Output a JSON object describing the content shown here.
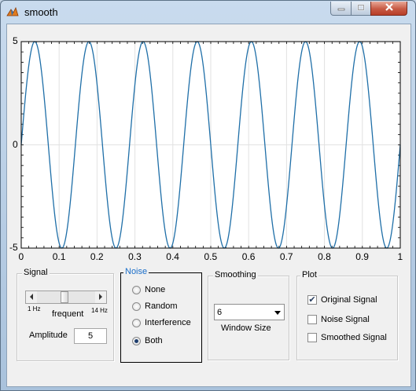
{
  "window": {
    "title": "smooth"
  },
  "icons": {
    "app": "matlab-figure-icon",
    "minimize": "minimize-icon",
    "maximize": "maximize-icon",
    "close": "close-icon"
  },
  "colors": {
    "signal_line": "#1f6fa8",
    "noise_title": "#1a6ec9"
  },
  "chart_data": {
    "type": "line",
    "series": [
      {
        "kind": "sine",
        "frequency_hz": 7,
        "amplitude": 5
      }
    ],
    "xlim": [
      0,
      1
    ],
    "ylim": [
      -5,
      5
    ],
    "xticks": [
      "0",
      "0.1",
      "0.2",
      "0.3",
      "0.4",
      "0.5",
      "0.6",
      "0.7",
      "0.8",
      "0.9",
      "1"
    ],
    "yticks": [
      "5",
      "0",
      "-5"
    ],
    "grid": true
  },
  "signal_panel": {
    "title": "Signal",
    "slider_min_label": "1 Hz",
    "slider_max_label": "14 Hz",
    "slider_caption": "frequent",
    "slider_value_hz": 7,
    "amplitude_label": "Amplitude",
    "amplitude_value": "5"
  },
  "noise_panel": {
    "title": "Noise",
    "options": [
      "None",
      "Random",
      "Interference",
      "Both"
    ],
    "selected": "Both"
  },
  "smoothing_panel": {
    "title": "Smoothing",
    "window_value": "6",
    "window_label": "Window Size"
  },
  "plot_panel": {
    "title": "Plot",
    "options": [
      {
        "label": "Original Signal",
        "checked": true
      },
      {
        "label": "Noise Signal",
        "checked": false
      },
      {
        "label": "Smoothed Signal",
        "checked": false
      }
    ]
  }
}
